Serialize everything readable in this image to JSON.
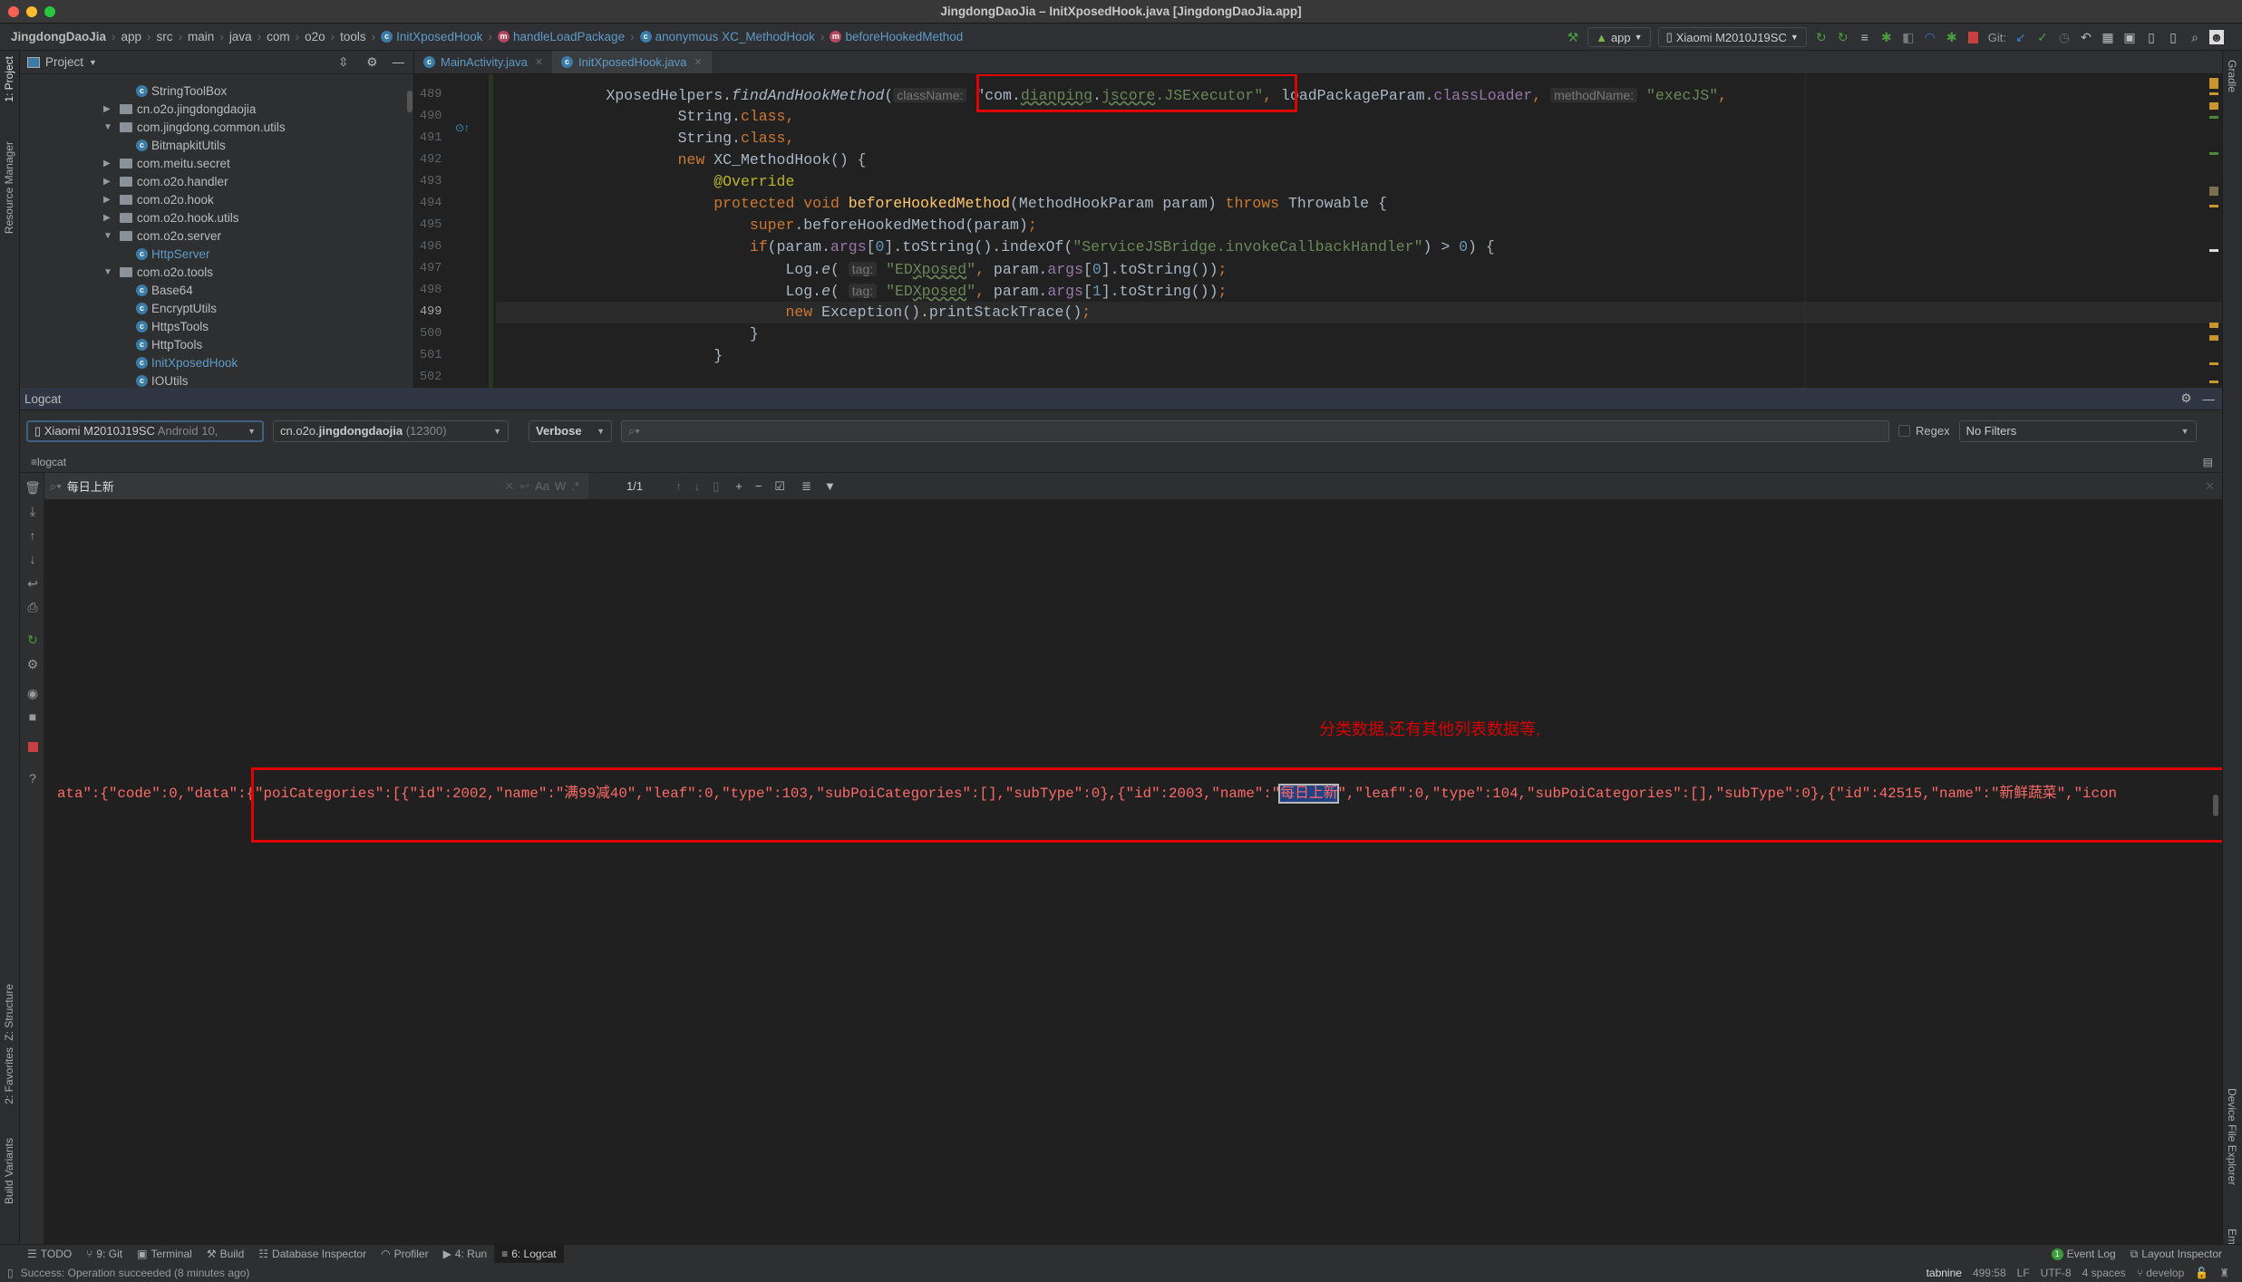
{
  "window": {
    "title": "JingdongDaoJia – InitXposedHook.java [JingdongDaoJia.app]"
  },
  "breadcrumbs": [
    {
      "label": "JingdongDaoJia",
      "icon": ""
    },
    {
      "label": "app",
      "icon": ""
    },
    {
      "label": "src",
      "icon": ""
    },
    {
      "label": "main",
      "icon": ""
    },
    {
      "label": "java",
      "icon": ""
    },
    {
      "label": "com",
      "icon": ""
    },
    {
      "label": "o2o",
      "icon": ""
    },
    {
      "label": "tools",
      "icon": ""
    },
    {
      "label": "InitXposedHook",
      "icon": "class-icon"
    },
    {
      "label": "handleLoadPackage",
      "icon": "method-icon"
    },
    {
      "label": "anonymous XC_MethodHook",
      "icon": "anonymous-class-icon"
    },
    {
      "label": "beforeHookedMethod",
      "icon": "method-icon"
    }
  ],
  "toolbar": {
    "run_config": "app",
    "device": "Xiaomi M2010J19SC",
    "git_label": "Git:"
  },
  "left_strip": {
    "project": "1: Project",
    "resource_manager": "Resource Manager",
    "structure": "Z: Structure",
    "favorites": "2: Favorites",
    "build_variants": "Build Variants"
  },
  "right_strip": {
    "gradle": "Gradle",
    "device_file_explorer": "Device File Explorer",
    "emulator": "Emulator"
  },
  "project": {
    "title": "Project",
    "tree": [
      {
        "label": "StringToolBox",
        "type": "class",
        "level": 2
      },
      {
        "label": "cn.o2o.jingdongdaojia",
        "type": "package",
        "expanded": false,
        "level": 1
      },
      {
        "label": "com.jingdong.common.utils",
        "type": "package",
        "expanded": true,
        "level": 1
      },
      {
        "label": "BitmapkitUtils",
        "type": "class",
        "level": 2
      },
      {
        "label": "com.meitu.secret",
        "type": "package",
        "expanded": false,
        "level": 1
      },
      {
        "label": "com.o2o.handler",
        "type": "package",
        "expanded": false,
        "level": 1
      },
      {
        "label": "com.o2o.hook",
        "type": "package",
        "expanded": false,
        "level": 1
      },
      {
        "label": "com.o2o.hook.utils",
        "type": "package",
        "expanded": false,
        "level": 1
      },
      {
        "label": "com.o2o.server",
        "type": "package",
        "expanded": true,
        "level": 1
      },
      {
        "label": "HttpServer",
        "type": "class",
        "level": 2,
        "highlight": true
      },
      {
        "label": "com.o2o.tools",
        "type": "package",
        "expanded": true,
        "level": 1
      },
      {
        "label": "Base64",
        "type": "class",
        "level": 2
      },
      {
        "label": "EncryptUtils",
        "type": "class",
        "level": 2
      },
      {
        "label": "HttpsTools",
        "type": "class",
        "level": 2
      },
      {
        "label": "HttpTools",
        "type": "class",
        "level": 2
      },
      {
        "label": "InitXposedHook",
        "type": "class",
        "level": 2,
        "highlight": true
      },
      {
        "label": "IOUtils",
        "type": "class",
        "level": 2
      }
    ]
  },
  "editor": {
    "tabs": [
      {
        "label": "MainActivity.java",
        "active": false
      },
      {
        "label": "InitXposedHook.java",
        "active": true
      }
    ],
    "current_line": 499,
    "lines": [
      {
        "n": 489,
        "indent": 16,
        "tokens": [
          [
            "XposedHelpers.",
            ""
          ],
          [
            "findAndHookMethod",
            "it"
          ],
          [
            "(",
            ""
          ],
          [
            "className:",
            "hint"
          ],
          [
            " ",
            ""
          ],
          [
            "\"com.",
            ""
          ],
          [
            "dianping",
            "s wavy"
          ],
          [
            ".",
            ""
          ],
          [
            "jscore",
            "s wavy"
          ],
          [
            ".JSExecutor\"",
            "s"
          ],
          [
            ",",
            "k"
          ],
          [
            " loadPackageParam.",
            ""
          ],
          [
            "classLoader",
            "f"
          ],
          [
            ",",
            "k"
          ],
          [
            " ",
            ""
          ],
          [
            "methodName:",
            "hint"
          ],
          [
            " ",
            ""
          ],
          [
            "\"execJS\"",
            "s"
          ],
          [
            ",",
            "k"
          ]
        ]
      },
      {
        "n": 490,
        "indent": 24,
        "tokens": [
          [
            "String.",
            ""
          ],
          [
            "class",
            "k"
          ],
          [
            ",",
            "k"
          ]
        ]
      },
      {
        "n": 491,
        "indent": 24,
        "tokens": [
          [
            "String.",
            ""
          ],
          [
            "class",
            "k"
          ],
          [
            ",",
            "k"
          ]
        ]
      },
      {
        "n": 492,
        "indent": 24,
        "tokens": [
          [
            "new ",
            "k"
          ],
          [
            "XC_MethodHook() {",
            ""
          ]
        ]
      },
      {
        "n": 493,
        "indent": 28,
        "tokens": [
          [
            "@Override",
            "a"
          ]
        ]
      },
      {
        "n": 494,
        "indent": 28,
        "tokens": [
          [
            "protected void ",
            "k"
          ],
          [
            "beforeHookedMethod",
            "fn"
          ],
          [
            "(MethodHookParam param) ",
            ""
          ],
          [
            "throws ",
            "k"
          ],
          [
            "Throwable {",
            ""
          ]
        ]
      },
      {
        "n": 495,
        "indent": 32,
        "tokens": [
          [
            "super",
            "k"
          ],
          [
            ".beforeHookedMethod(param)",
            ""
          ],
          [
            ";",
            "k"
          ]
        ]
      },
      {
        "n": 496,
        "indent": 32,
        "tokens": [
          [
            "if",
            "k"
          ],
          [
            "(param.",
            ""
          ],
          [
            "args",
            "f"
          ],
          [
            "[",
            ""
          ],
          [
            "0",
            "n"
          ],
          [
            "].toString().indexOf(",
            ""
          ],
          [
            "\"ServiceJSBridge.invokeCallbackHandler\"",
            "s"
          ],
          [
            ") > ",
            ""
          ],
          [
            "0",
            "n"
          ],
          [
            ") {",
            ""
          ]
        ]
      },
      {
        "n": 497,
        "indent": 36,
        "tokens": [
          [
            "Log.",
            ""
          ],
          [
            "e",
            "it"
          ],
          [
            "( ",
            ""
          ],
          [
            "tag:",
            "hint"
          ],
          [
            " ",
            ""
          ],
          [
            "\"ED",
            "s"
          ],
          [
            "Xposed",
            "s wavy"
          ],
          [
            "\"",
            "s"
          ],
          [
            ", ",
            "k"
          ],
          [
            "param.",
            ""
          ],
          [
            "args",
            "f"
          ],
          [
            "[",
            ""
          ],
          [
            "0",
            "n"
          ],
          [
            "].toString())",
            ""
          ],
          [
            ";",
            "k"
          ]
        ]
      },
      {
        "n": 498,
        "indent": 36,
        "tokens": [
          [
            "Log.",
            ""
          ],
          [
            "e",
            "it"
          ],
          [
            "( ",
            ""
          ],
          [
            "tag:",
            "hint"
          ],
          [
            " ",
            ""
          ],
          [
            "\"ED",
            "s"
          ],
          [
            "Xposed",
            "s wavy"
          ],
          [
            "\"",
            "s"
          ],
          [
            ", ",
            "k"
          ],
          [
            "param.",
            ""
          ],
          [
            "args",
            "f"
          ],
          [
            "[",
            ""
          ],
          [
            "1",
            "n"
          ],
          [
            "].toString())",
            ""
          ],
          [
            ";",
            "k"
          ]
        ]
      },
      {
        "n": 499,
        "indent": 36,
        "tokens": [
          [
            "new ",
            "k"
          ],
          [
            "Exception().printStackTrace()",
            ""
          ],
          [
            ";",
            "k"
          ]
        ]
      },
      {
        "n": 500,
        "indent": 32,
        "tokens": [
          [
            "}",
            ""
          ]
        ]
      },
      {
        "n": 501,
        "indent": 28,
        "tokens": [
          [
            "}",
            ""
          ]
        ]
      },
      {
        "n": 502,
        "indent": 0,
        "tokens": []
      }
    ]
  },
  "logcat": {
    "title": "Logcat",
    "device": "Xiaomi M2010J19SC",
    "device_os": "Android 10,",
    "process_prefix": "cn.o2o.",
    "process_name": "jingdongdaojia",
    "process_pid": "(12300)",
    "level": "Verbose",
    "search_value": "",
    "regex_label": "Regex",
    "regex_checked": false,
    "filter": "No Filters",
    "tab_label": "logcat",
    "find_value": "每日上新",
    "find_count": "1/1",
    "find_options": [
      "Aa",
      "W",
      ".*"
    ],
    "annotation": "分类数据,还有其他列表数据等,",
    "log_before": "ata\":{\"code\":0,\"data\":{\"poiCategories\":[{\"id\":2002,\"name\":\"满99减40\",\"leaf\":0,\"type\":103,\"subPoiCategories\":[],\"subType\":0},{\"id\":2003,\"name\":\"",
    "log_highlight": "每日上新",
    "log_after": "\",\"leaf\":0,\"type\":104,\"subPoiCategories\":[],\"subType\":0},{\"id\":42515,\"name\":\"新鲜蔬菜\",\"icon",
    "annotation_color": "#d90000",
    "log_color": "#ff6b68"
  },
  "bottom_tools": [
    {
      "label": "TODO",
      "icon": "list-icon"
    },
    {
      "label": "9: Git",
      "icon": "git-icon"
    },
    {
      "label": "Terminal",
      "icon": "terminal-icon"
    },
    {
      "label": "Build",
      "icon": "hammer-icon"
    },
    {
      "label": "Database Inspector",
      "icon": "database-icon"
    },
    {
      "label": "Profiler",
      "icon": "gauge-icon"
    },
    {
      "label": "4: Run",
      "icon": "run-icon"
    },
    {
      "label": "6: Logcat",
      "icon": "logcat-icon",
      "active": true
    }
  ],
  "bottom_right_tools": [
    {
      "label": "Event Log",
      "badge": "1"
    },
    {
      "label": "Layout Inspector"
    }
  ],
  "status": {
    "message": "Success: Operation succeeded (8 minutes ago)",
    "tabnine": "tabnine",
    "position": "499:58",
    "line_sep": "LF",
    "encoding": "UTF-8",
    "indent": "4 spaces",
    "branch": "develop"
  }
}
